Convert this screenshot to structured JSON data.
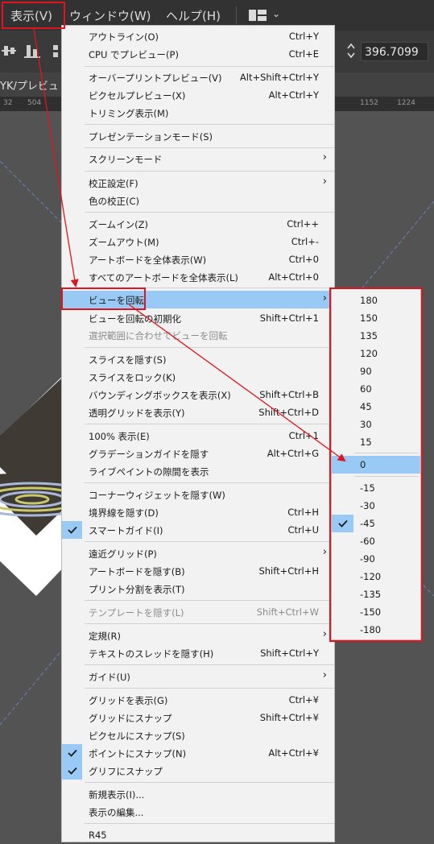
{
  "menubar": {
    "items": [
      "表示(V)",
      "ウィンドウ(W)",
      "ヘルプ(H)"
    ],
    "workspace_chevron": "⌄"
  },
  "control_bar": {
    "value": "396.7099"
  },
  "doc_tab": {
    "title": "YK/プレビュ"
  },
  "ruler": {
    "ticks": [
      "32",
      "504",
      "1152",
      "1224"
    ]
  },
  "view_menu": {
    "items": [
      {
        "label": "アウトライン(O)",
        "shortcut": "Ctrl+Y"
      },
      {
        "label": "CPU でプレビュー(P)",
        "shortcut": "Ctrl+E"
      },
      {
        "label": "オーバープリントプレビュー(V)",
        "shortcut": "Alt+Shift+Ctrl+Y"
      },
      {
        "label": "ピクセルプレビュー(X)",
        "shortcut": "Alt+Ctrl+Y"
      },
      {
        "label": "トリミング表示(M)",
        "shortcut": ""
      },
      {
        "label": "プレゼンテーションモード(S)",
        "shortcut": ""
      },
      {
        "label": "スクリーンモード",
        "shortcut": "",
        "submenu": true
      },
      {
        "label": "校正設定(F)",
        "shortcut": "",
        "submenu": true
      },
      {
        "label": "色の校正(C)",
        "shortcut": ""
      },
      {
        "label": "ズームイン(Z)",
        "shortcut": "Ctrl++"
      },
      {
        "label": "ズームアウト(M)",
        "shortcut": "Ctrl+-"
      },
      {
        "label": "アートボードを全体表示(W)",
        "shortcut": "Ctrl+0"
      },
      {
        "label": "すべてのアートボードを全体表示(L)",
        "shortcut": "Alt+Ctrl+0"
      },
      {
        "label": "ビューを回転",
        "shortcut": "",
        "submenu": true,
        "highlighted": true
      },
      {
        "label": "ビューを回転の初期化",
        "shortcut": "Shift+Ctrl+1"
      },
      {
        "label": "選択範囲に合わせてビューを回転",
        "shortcut": "",
        "disabled": true
      },
      {
        "label": "スライスを隠す(S)",
        "shortcut": ""
      },
      {
        "label": "スライスをロック(K)",
        "shortcut": ""
      },
      {
        "label": "バウンディングボックスを表示(X)",
        "shortcut": "Shift+Ctrl+B"
      },
      {
        "label": "透明グリッドを表示(Y)",
        "shortcut": "Shift+Ctrl+D"
      },
      {
        "label": "100% 表示(E)",
        "shortcut": "Ctrl+1"
      },
      {
        "label": "グラデーションガイドを隠す",
        "shortcut": "Alt+Ctrl+G"
      },
      {
        "label": "ライブペイントの隙間を表示",
        "shortcut": ""
      },
      {
        "label": "コーナーウィジェットを隠す(W)",
        "shortcut": ""
      },
      {
        "label": "境界線を隠す(D)",
        "shortcut": "Ctrl+H"
      },
      {
        "label": "スマートガイド(I)",
        "shortcut": "Ctrl+U",
        "checked": true
      },
      {
        "label": "遠近グリッド(P)",
        "shortcut": "",
        "submenu": true
      },
      {
        "label": "アートボードを隠す(B)",
        "shortcut": "Shift+Ctrl+H"
      },
      {
        "label": "プリント分割を表示(T)",
        "shortcut": ""
      },
      {
        "label": "テンプレートを隠す(L)",
        "shortcut": "Shift+Ctrl+W",
        "disabled": true
      },
      {
        "label": "定規(R)",
        "shortcut": "",
        "submenu": true
      },
      {
        "label": "テキストのスレッドを隠す(H)",
        "shortcut": "Shift+Ctrl+Y"
      },
      {
        "label": "ガイド(U)",
        "shortcut": "",
        "submenu": true
      },
      {
        "label": "グリッドを表示(G)",
        "shortcut": "Ctrl+¥"
      },
      {
        "label": "グリッドにスナップ",
        "shortcut": "Shift+Ctrl+¥"
      },
      {
        "label": "ピクセルにスナップ(S)",
        "shortcut": ""
      },
      {
        "label": "ポイントにスナップ(N)",
        "shortcut": "Alt+Ctrl+¥",
        "checked": true
      },
      {
        "label": "グリフにスナップ",
        "shortcut": "",
        "checked": true
      },
      {
        "label": "新規表示(I)...",
        "shortcut": ""
      },
      {
        "label": "表示の編集...",
        "shortcut": ""
      },
      {
        "label": "R45",
        "shortcut": ""
      }
    ]
  },
  "rotate_submenu": {
    "items": [
      {
        "label": "180"
      },
      {
        "label": "150"
      },
      {
        "label": "135"
      },
      {
        "label": "120"
      },
      {
        "label": "90"
      },
      {
        "label": "60"
      },
      {
        "label": "45"
      },
      {
        "label": "30"
      },
      {
        "label": "15"
      },
      {
        "label": "0",
        "highlighted": true
      },
      {
        "label": "-15"
      },
      {
        "label": "-30"
      },
      {
        "label": "-45",
        "checked": true
      },
      {
        "label": "-60"
      },
      {
        "label": "-90"
      },
      {
        "label": "-120"
      },
      {
        "label": "-135"
      },
      {
        "label": "-150"
      },
      {
        "label": "-180"
      }
    ]
  },
  "colors": {
    "highlight": "#99c9f5",
    "annotation_red": "#e0141e",
    "menu_bg": "#f2f2f2",
    "app_bg": "#323232"
  }
}
